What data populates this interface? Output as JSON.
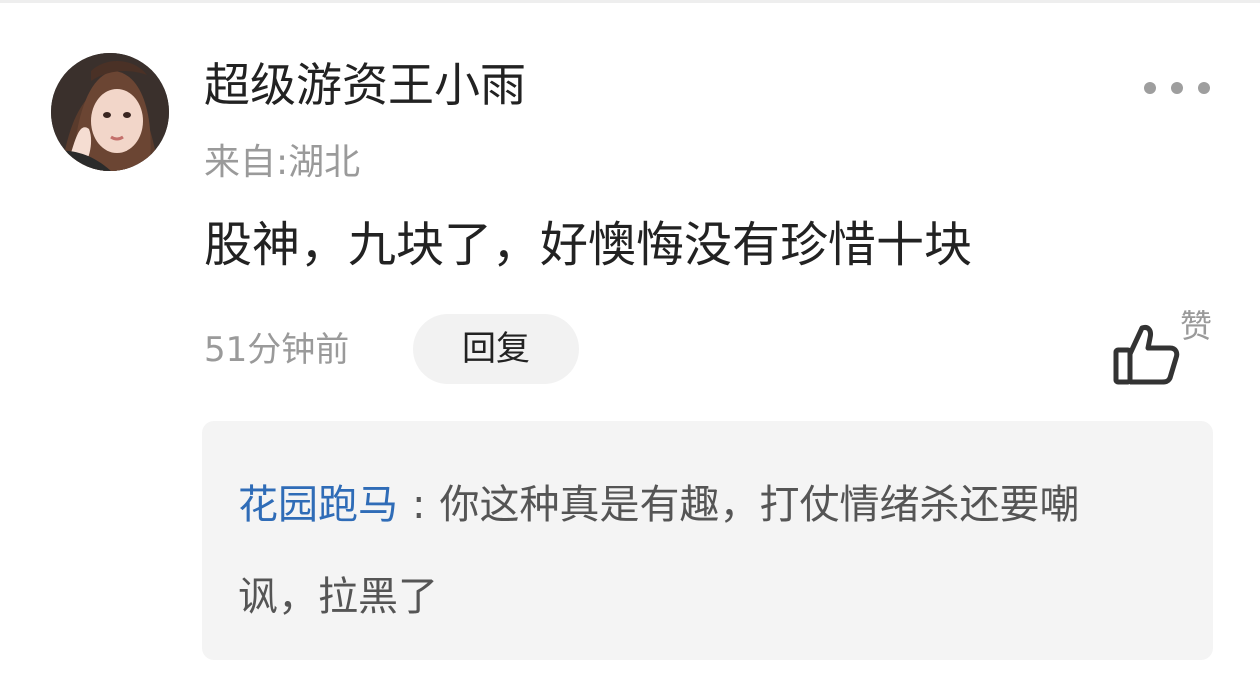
{
  "comment": {
    "username": "超级游资王小雨",
    "location": "来自:湖北",
    "text": "股神，九块了，好懊悔没有珍惜十块",
    "time": "51分钟前",
    "reply_label": "回复",
    "like_label": "赞"
  },
  "sub_reply": {
    "author": "花园跑马",
    "separator": ":",
    "text": "你这种真是有趣，打仗情绪杀还要嘲讽，拉黑了"
  },
  "colors": {
    "author_link": "#2f6cb7",
    "secondary_text": "#9a9a9a",
    "reply_box_bg": "#f4f4f4"
  },
  "icons": {
    "more": "more-dots-icon",
    "like": "thumbs-up-icon"
  }
}
